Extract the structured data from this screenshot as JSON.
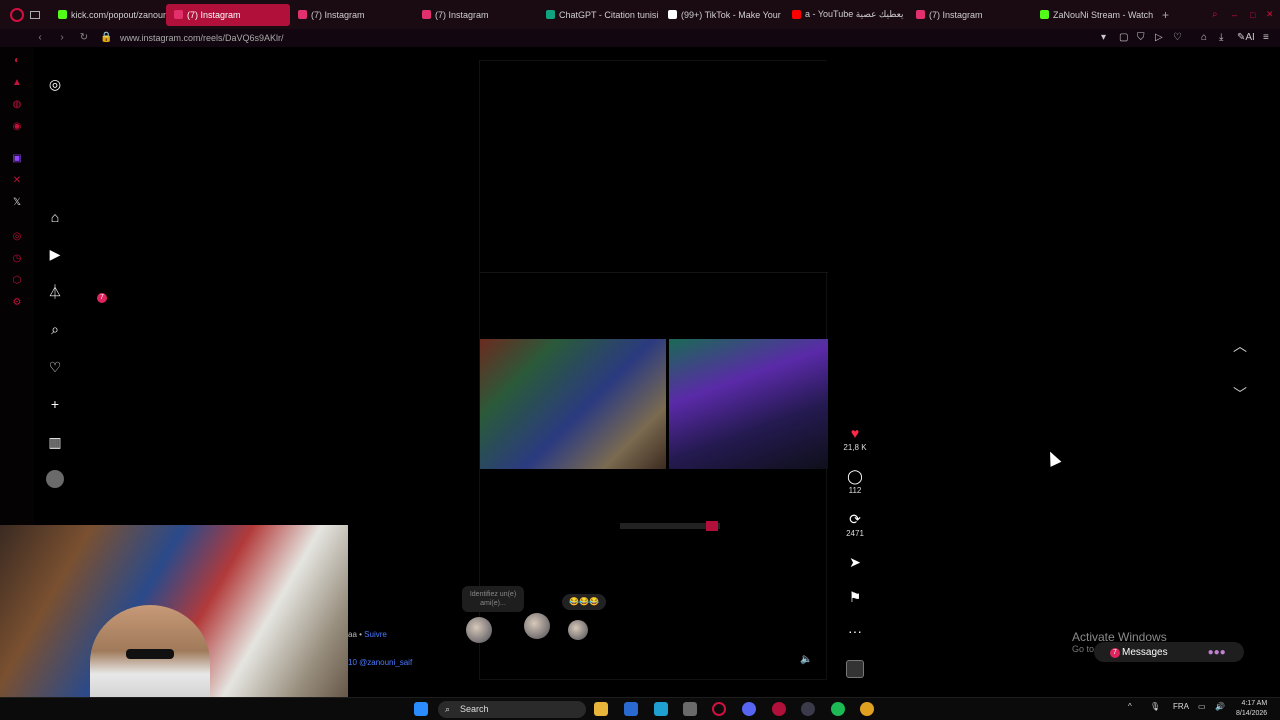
{
  "browser": {
    "tabs": [
      {
        "label": "kick.com/popout/zanouni",
        "color": "#53fc18"
      },
      {
        "label": "(7) Instagram",
        "color": "#e1306c",
        "active": true
      },
      {
        "label": "(7) Instagram",
        "color": "#e1306c"
      },
      {
        "label": "(7) Instagram",
        "color": "#e1306c"
      },
      {
        "label": "ChatGPT - Citation tunisi",
        "color": "#10a37f"
      },
      {
        "label": "(99+) TikTok - Make Your",
        "color": "#ffffff"
      },
      {
        "label": "a - YouTube يعطيك عصية",
        "color": "#ff0000"
      },
      {
        "label": "(7) Instagram",
        "color": "#e1306c"
      },
      {
        "label": "ZaNouNi Stream - Watch",
        "color": "#53fc18"
      }
    ],
    "url": "www.instagram.com/reels/DaVQ6s9AKlr/"
  },
  "ig_nav": {
    "notification_count": "7"
  },
  "reel": {
    "tag_prompt": "Identifiez un(e) ami(e)...",
    "emoji_reactions": "😂😂😂",
    "likes": "21,8 K",
    "comments": "112",
    "reposts": "2471"
  },
  "overlay": {
    "follow_text": "aa •",
    "follow_link": "Suivre",
    "handle": "10 @zanouni_saif"
  },
  "windows": {
    "activate_title": "Activate Windows",
    "activate_sub": "Go to",
    "messages_label": "Messages",
    "messages_badge": "7"
  },
  "taskbar": {
    "search_label": "Search",
    "lang": "FRA",
    "time": "4:17 AM",
    "date": "8/14/2026"
  },
  "colors": {
    "accent": "#b0103a",
    "like": "#ff2a4a",
    "link": "#4a7bff"
  }
}
